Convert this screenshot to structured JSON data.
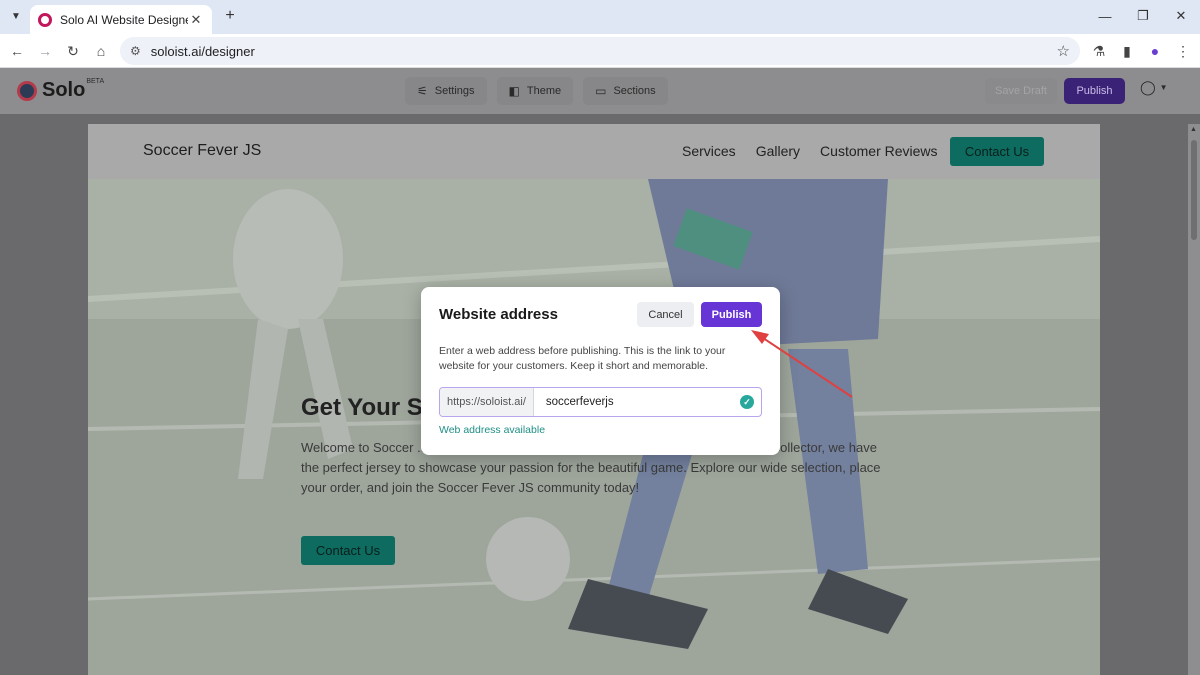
{
  "browser": {
    "tab_title": "Solo AI Website Designer",
    "url": "soloist.ai/designer"
  },
  "app": {
    "logo_text": "Solo",
    "beta_label": "BETA",
    "nav": [
      {
        "label": "Settings",
        "icon": "sliders-icon"
      },
      {
        "label": "Theme",
        "icon": "palette-icon"
      },
      {
        "label": "Sections",
        "icon": "sections-icon"
      }
    ],
    "save_draft_label": "Save Draft",
    "publish_label": "Publish"
  },
  "site_preview": {
    "brand": "Soccer Fever JS",
    "nav_links": [
      "Services",
      "Gallery",
      "Customer Reviews"
    ],
    "nav_cta": "Contact Us",
    "hero_title": "Get Your Sc",
    "hero_text": "Welcome to Soccer ... eys in Los Angeles. Whether you're a soccer player, fan, or collector, we have the perfect jersey to showcase your passion for the beautiful game. Explore our wide selection, place your order, and join the Soccer Fever JS community today!",
    "hero_cta": "Contact Us"
  },
  "modal": {
    "title": "Website address",
    "cancel_label": "Cancel",
    "publish_label": "Publish",
    "description": "Enter a web address before publishing. This is the link to your website for your customers. Keep it short and memorable.",
    "address_prefix": "https://soloist.ai/",
    "address_value": "soccerfeverjs",
    "status_text": "Web address available"
  },
  "colors": {
    "accent_purple": "#6734d6",
    "available_green": "#1f8f85",
    "site_teal": "#0d6b5f",
    "annotation_arrow": "#e04040"
  }
}
